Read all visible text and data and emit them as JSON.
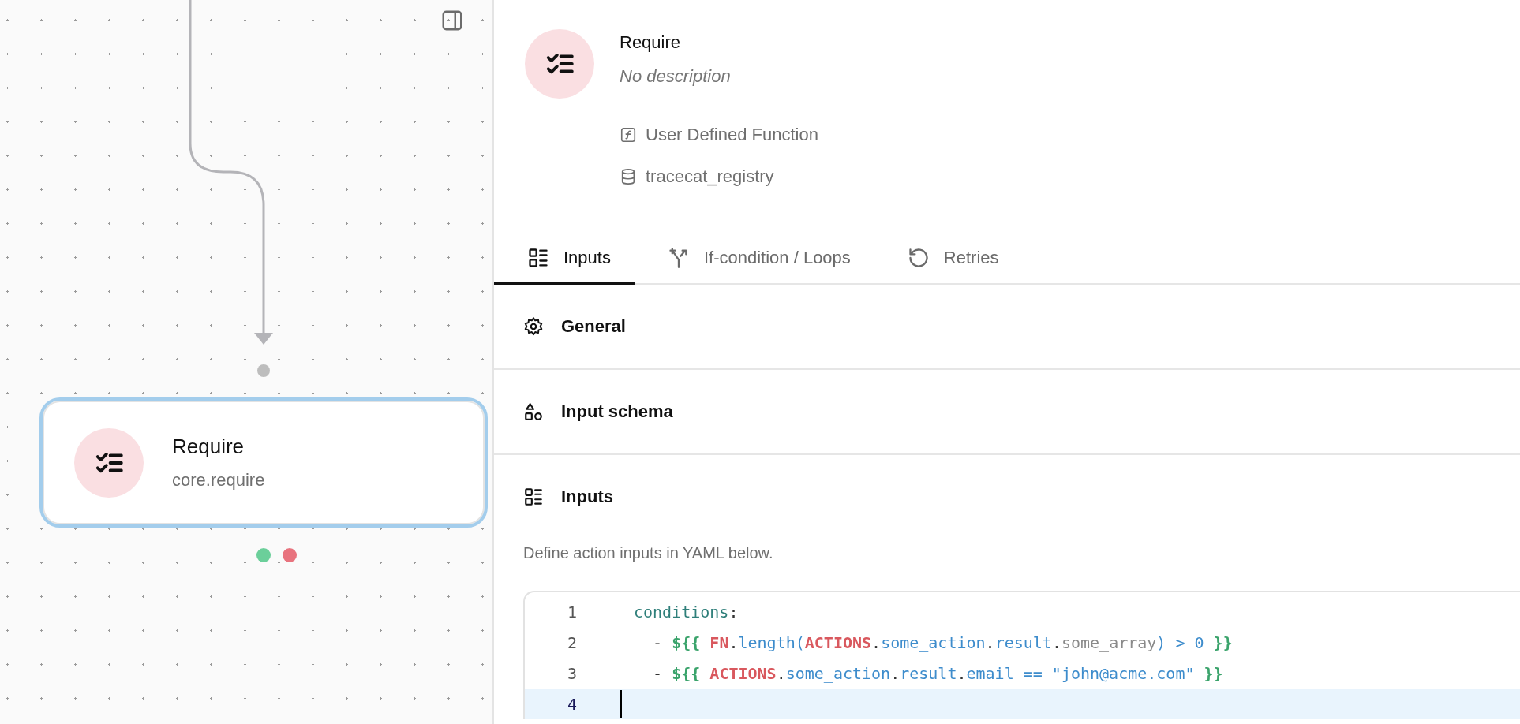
{
  "canvas": {
    "node": {
      "title": "Require",
      "subtitle": "core.require",
      "selected": true
    },
    "handles": [
      {
        "color": "#6bcf9a"
      },
      {
        "color": "#e8737e"
      }
    ]
  },
  "panel": {
    "title": "Require",
    "description": "No description",
    "meta": [
      {
        "kind": "function",
        "text": "User Defined Function"
      },
      {
        "kind": "registry",
        "text": "tracecat_registry"
      }
    ],
    "tabs": [
      {
        "label": "Inputs",
        "selected": true
      },
      {
        "label": "If-condition / Loops",
        "selected": false
      },
      {
        "label": "Retries",
        "selected": false
      }
    ],
    "sections": [
      {
        "title": "General"
      },
      {
        "title": "Input schema"
      },
      {
        "title": "Inputs",
        "hint": "Define action inputs in YAML below."
      }
    ],
    "editor": {
      "lines": [
        {
          "number": "1",
          "active": false,
          "tokens": [
            {
              "kind": "key",
              "text": "conditions"
            },
            {
              "kind": "punct",
              "text": ":"
            }
          ]
        },
        {
          "number": "2",
          "active": false,
          "tokens": [
            {
              "kind": "punct",
              "text": "  - "
            },
            {
              "kind": "brace",
              "text": "${{ "
            },
            {
              "kind": "keyword",
              "text": "FN"
            },
            {
              "kind": "punct",
              "text": "."
            },
            {
              "kind": "prop",
              "text": "length("
            },
            {
              "kind": "keyword",
              "text": "ACTIONS"
            },
            {
              "kind": "punct",
              "text": "."
            },
            {
              "kind": "prop",
              "text": "some_action"
            },
            {
              "kind": "punct",
              "text": "."
            },
            {
              "kind": "prop",
              "text": "result"
            },
            {
              "kind": "punct",
              "text": "."
            },
            {
              "kind": "attr",
              "text": "some_array"
            },
            {
              "kind": "prop",
              "text": ") > 0 "
            },
            {
              "kind": "brace",
              "text": "}}"
            }
          ]
        },
        {
          "number": "3",
          "active": false,
          "tokens": [
            {
              "kind": "punct",
              "text": "  - "
            },
            {
              "kind": "brace",
              "text": "${{ "
            },
            {
              "kind": "keyword",
              "text": "ACTIONS"
            },
            {
              "kind": "punct",
              "text": "."
            },
            {
              "kind": "prop",
              "text": "some_action"
            },
            {
              "kind": "punct",
              "text": "."
            },
            {
              "kind": "prop",
              "text": "result"
            },
            {
              "kind": "punct",
              "text": "."
            },
            {
              "kind": "prop",
              "text": "email == \"john@acme.com\" "
            },
            {
              "kind": "brace",
              "text": "}}"
            }
          ]
        },
        {
          "number": "4",
          "active": true
        }
      ]
    }
  }
}
